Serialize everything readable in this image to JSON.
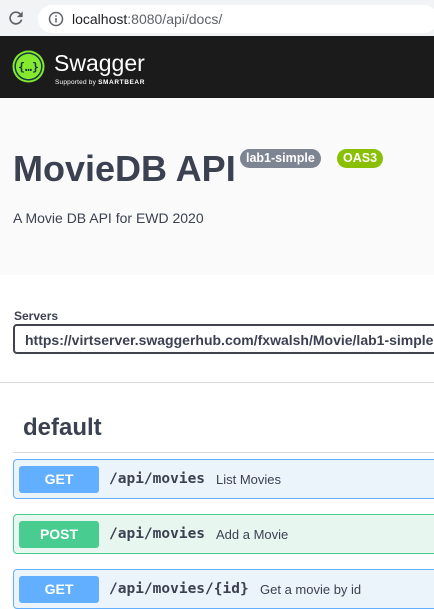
{
  "browser": {
    "url_host": "localhost",
    "url_rest": ":8080/api/docs/"
  },
  "swagger": {
    "brand": "Swagger",
    "supported_by": "Supported by",
    "company": "SMARTBEAR"
  },
  "info": {
    "title": "MovieDB API",
    "version_badge": "lab1-simple",
    "oas_badge": "OAS3",
    "description": "A Movie DB API for EWD 2020"
  },
  "servers": {
    "label": "Servers",
    "selected": "https://virtserver.swaggerhub.com/fxwalsh/Movie/lab1-simple"
  },
  "tag": {
    "name": "default"
  },
  "operations": [
    {
      "method": "GET",
      "path": "/api/movies",
      "summary": "List Movies"
    },
    {
      "method": "POST",
      "path": "/api/movies",
      "summary": "Add a Movie"
    },
    {
      "method": "GET",
      "path": "/api/movies/{id}",
      "summary": "Get a movie by id"
    }
  ],
  "colors": {
    "get": "#61affe",
    "post": "#49cc90",
    "oas_badge": "#89bf04",
    "version_badge": "#7d8492",
    "topbar": "#1b1b1b"
  }
}
